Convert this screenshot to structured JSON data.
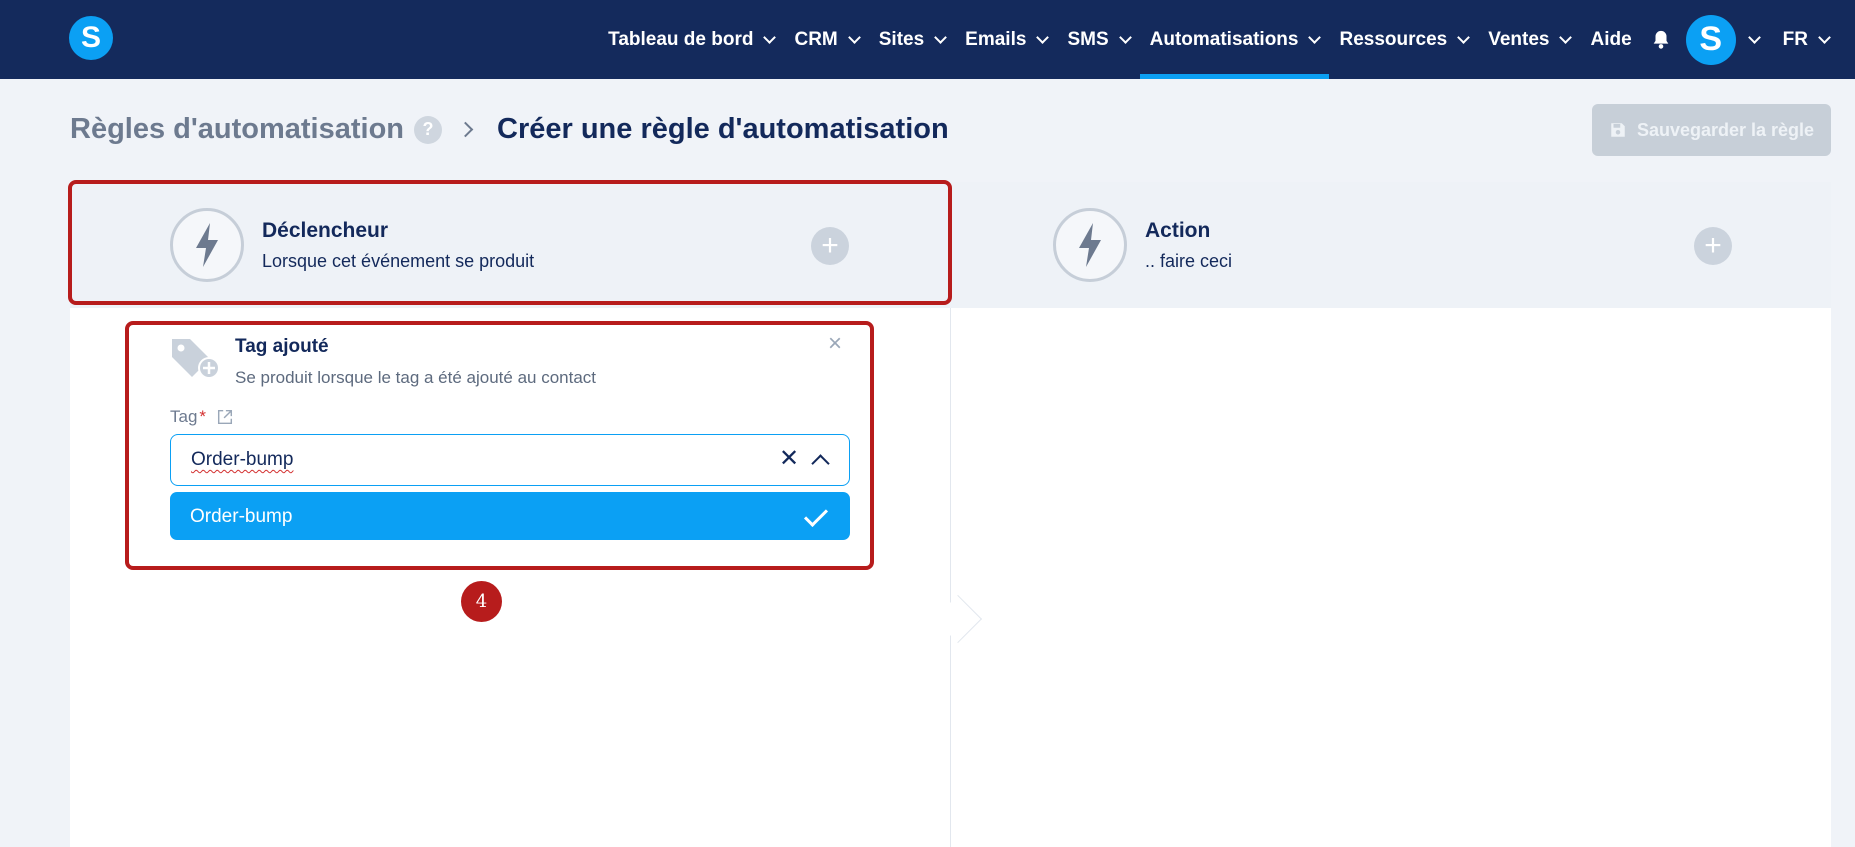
{
  "nav": {
    "logo": "S",
    "items": [
      {
        "label": "Tableau de bord",
        "dropdown": true
      },
      {
        "label": "CRM",
        "dropdown": true
      },
      {
        "label": "Sites",
        "dropdown": true
      },
      {
        "label": "Emails",
        "dropdown": true
      },
      {
        "label": "SMS",
        "dropdown": true
      },
      {
        "label": "Automatisations",
        "dropdown": true,
        "active": true
      },
      {
        "label": "Ressources",
        "dropdown": true
      },
      {
        "label": "Ventes",
        "dropdown": true
      },
      {
        "label": "Aide",
        "dropdown": false
      }
    ],
    "avatar": "S",
    "language": "FR"
  },
  "breadcrumb": {
    "parent": "Règles d'automatisation",
    "help": "?",
    "current": "Créer une règle d'automatisation"
  },
  "save_button": "Sauvegarder la règle",
  "steps": {
    "trigger": {
      "title": "Déclencheur",
      "subtitle": "Lorsque cet événement se produit"
    },
    "action": {
      "title": "Action",
      "subtitle": ".. faire ceci"
    },
    "plus": "+"
  },
  "trigger_card": {
    "title": "Tag ajouté",
    "subtitle": "Se produit lorsque le tag a été ajouté au contact",
    "close": "×",
    "field_label": "Tag",
    "required_mark": "*",
    "select_value": "Order-bump",
    "clear": "✕",
    "options": [
      "Order-bump"
    ]
  },
  "annotation_badge": "4",
  "colors": {
    "nav_bg": "#142a5c",
    "accent": "#0ba0f4",
    "highlight": "#b71c1c",
    "disabled_button": "#c7cfd8"
  }
}
